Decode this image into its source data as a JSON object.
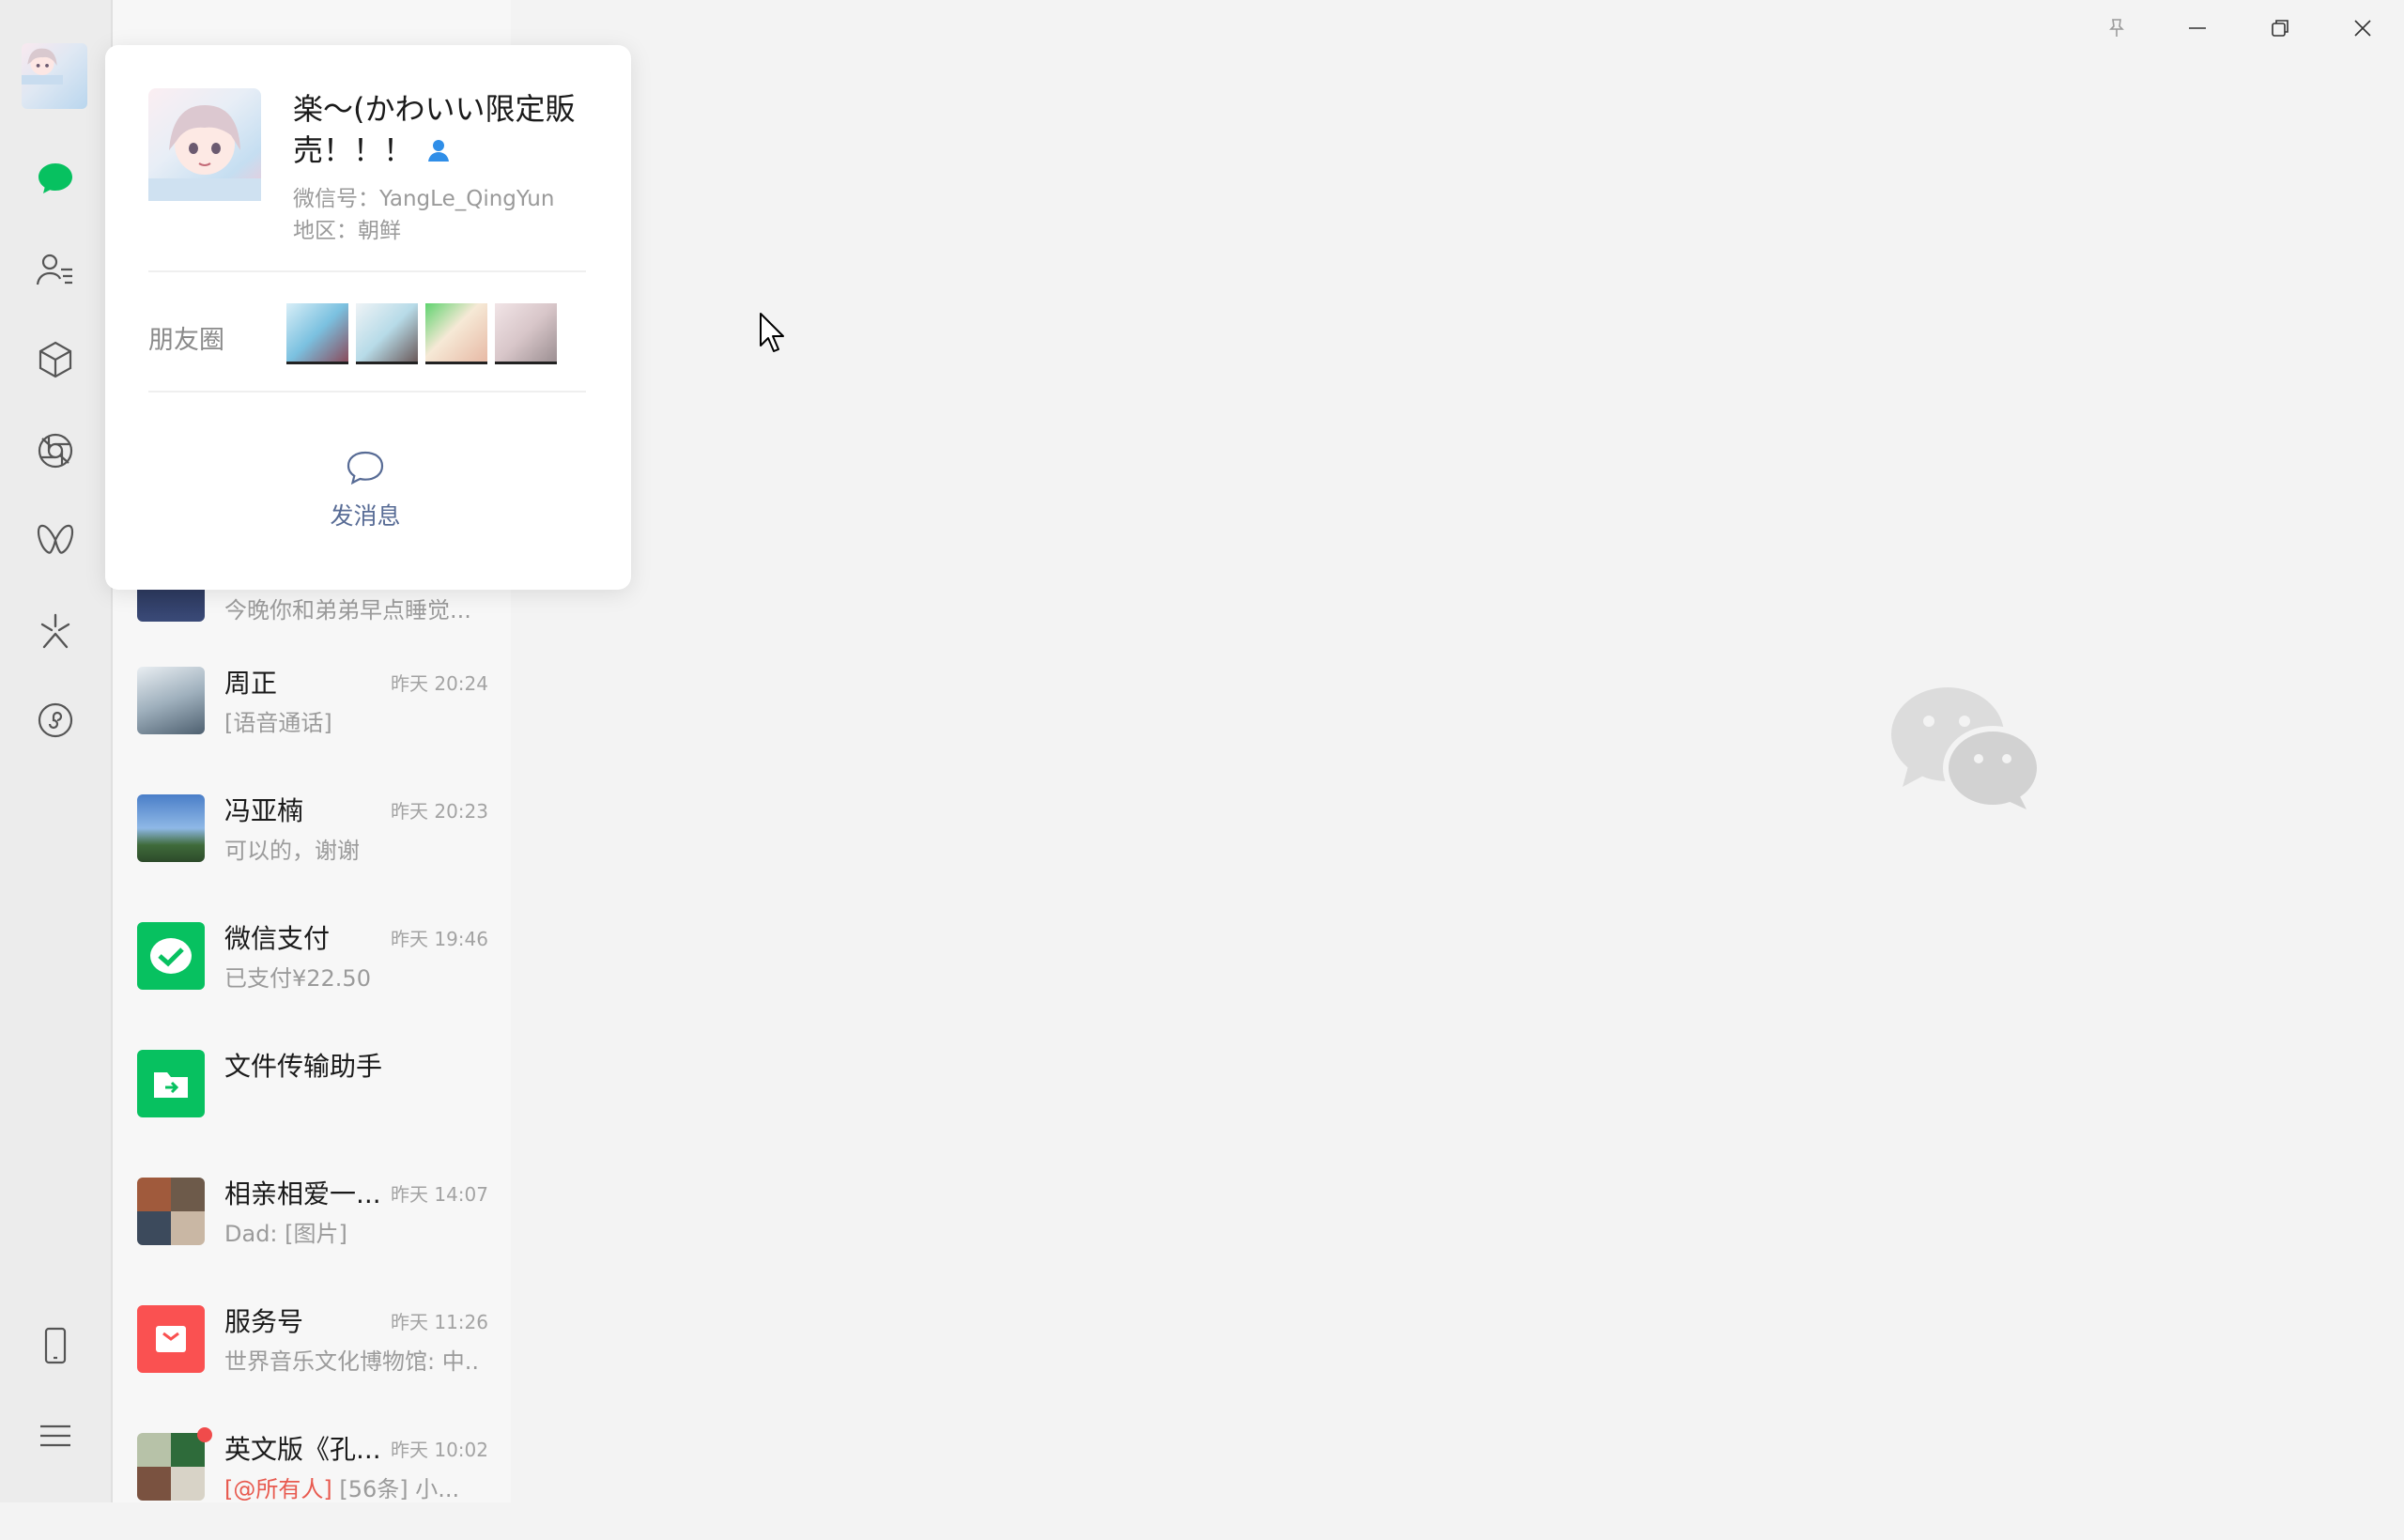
{
  "profile_card": {
    "name": "楽～(かわいい限定販売！！！",
    "wechat_id": "微信号：YangLe_QingYun",
    "region": "地区：朝鲜",
    "moments_label": "朋友圈",
    "send_message_label": "发消息"
  },
  "chats": [
    {
      "name": "",
      "time": "",
      "preview": "今晚你和弟弟早点睡觉..."
    },
    {
      "name": "周正",
      "time": "昨天 20:24",
      "preview": "[语音通话]"
    },
    {
      "name": "冯亚楠",
      "time": "昨天 20:23",
      "preview": "可以的，谢谢"
    },
    {
      "name": "微信支付",
      "time": "昨天 19:46",
      "preview": "已支付¥22.50"
    },
    {
      "name": "文件传输助手",
      "time": "",
      "preview": ""
    },
    {
      "name": "相亲相爱一...",
      "time": "昨天 14:07",
      "preview": "Dad: [图片]"
    },
    {
      "name": "服务号",
      "time": "昨天 11:26",
      "preview": "世界音乐文化博物馆: 中..."
    },
    {
      "name": "英文版《孔...",
      "time": "昨天 10:02",
      "preview_at": "[@所有人]",
      "preview": " [56条] 小..."
    }
  ],
  "colors": {
    "wechat_green": "#07c160",
    "service_red": "#fa5151",
    "link_blue": "#576b95",
    "unread_dot": "#f04b4b"
  }
}
